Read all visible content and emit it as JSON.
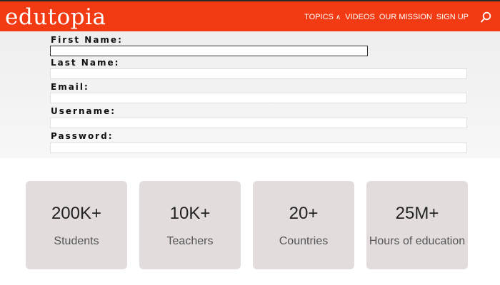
{
  "header": {
    "logo": "edutopia",
    "nav": [
      {
        "label": "TOPICS",
        "has_dropdown": true
      },
      {
        "label": "VIDEOS"
      },
      {
        "label": "OUR MISSION"
      },
      {
        "label": "SIGN UP"
      }
    ],
    "search_icon": "search-icon",
    "brand_color": "#f23b12"
  },
  "form": {
    "fields": [
      {
        "label": "First Name:",
        "value": ""
      },
      {
        "label": "Last Name:",
        "value": ""
      },
      {
        "label": "Email:",
        "value": ""
      },
      {
        "label": "Username:",
        "value": ""
      },
      {
        "label": "Password:",
        "value": ""
      }
    ]
  },
  "stats": [
    {
      "value": "200K+",
      "label": "Students"
    },
    {
      "value": "10K+",
      "label": "Teachers"
    },
    {
      "value": "20+",
      "label": "Countries"
    },
    {
      "value": "25M+",
      "label": "Hours of education"
    }
  ],
  "colors": {
    "card_bg": "#e2dcdc",
    "header_bg": "#f23b12"
  }
}
